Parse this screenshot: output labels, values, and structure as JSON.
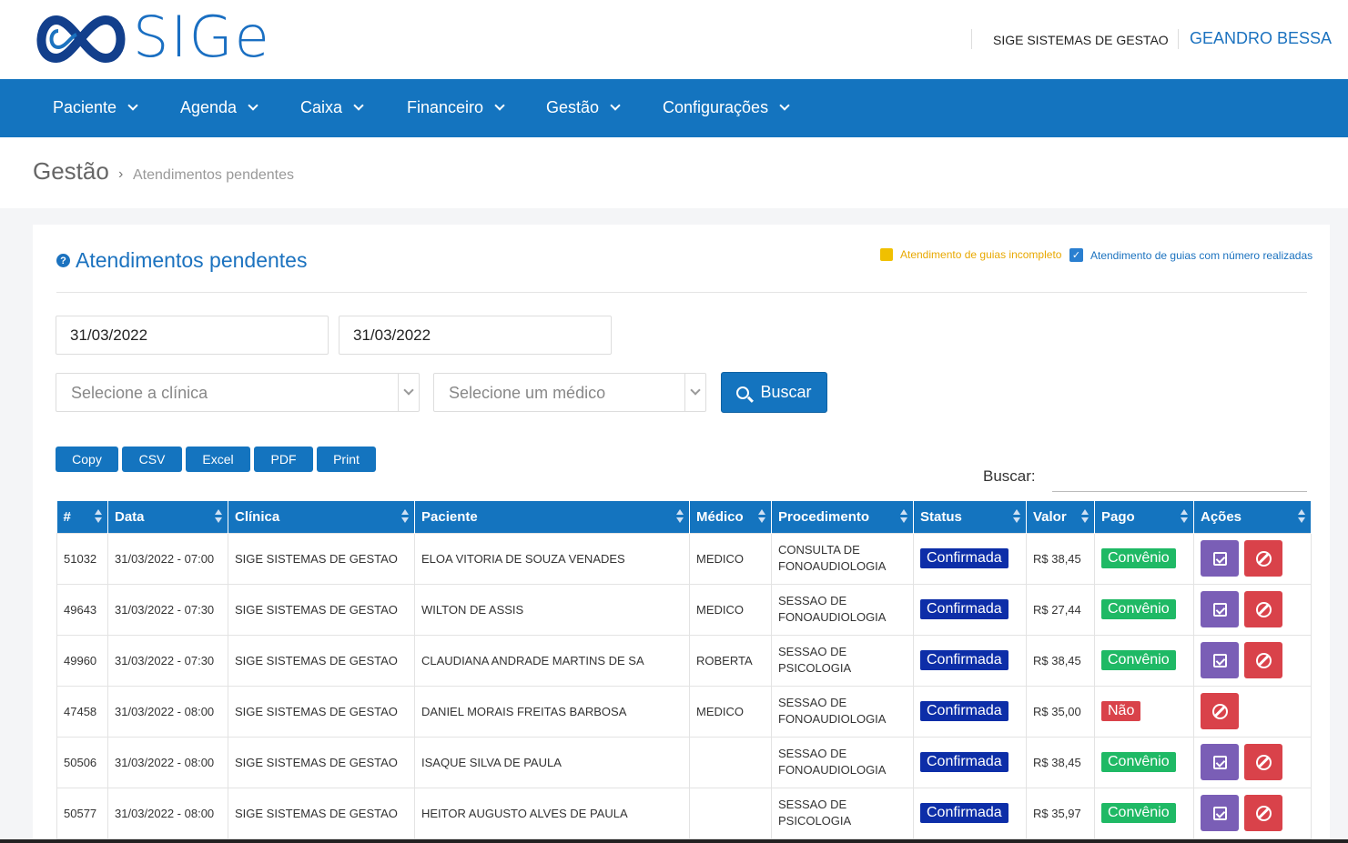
{
  "header": {
    "logo_text": "SIGe",
    "company": "SIGE SISTEMAS DE GESTAO",
    "user": "GEANDRO BESSA"
  },
  "nav": [
    {
      "label": "Paciente"
    },
    {
      "label": "Agenda"
    },
    {
      "label": "Caixa"
    },
    {
      "label": "Financeiro"
    },
    {
      "label": "Gestão"
    },
    {
      "label": "Configurações"
    }
  ],
  "breadcrumb": {
    "main": "Gestão",
    "separator": "›",
    "sub": "Atendimentos pendentes"
  },
  "card": {
    "title": "Atendimentos pendentes",
    "legend_incomplete": "Atendimento de guias incompleto",
    "legend_done": "Atendimento de guias com número realizadas"
  },
  "filters": {
    "date_start": "31/03/2022",
    "date_end": "31/03/2022",
    "clinic_placeholder": "Selecione a clínica",
    "doctor_placeholder": "Selecione um médico",
    "search_button": "Buscar"
  },
  "export": {
    "copy": "Copy",
    "csv": "CSV",
    "excel": "Excel",
    "pdf": "PDF",
    "print": "Print"
  },
  "table_search_label": "Buscar:",
  "table": {
    "columns": [
      "#",
      "Data",
      "Clínica",
      "Paciente",
      "Médico",
      "Procedimento",
      "Status",
      "Valor",
      "Pago",
      "Ações"
    ],
    "rows": [
      {
        "id": "51032",
        "data": "31/03/2022 - 07:00",
        "clinica": "SIGE SISTEMAS DE GESTAO",
        "paciente": "ELOA VITORIA DE SOUZA VENADES",
        "medico": "MEDICO",
        "proc1": "CONSULTA DE",
        "proc2": "FONOAUDIOLOGIA",
        "status": "Confirmada",
        "valor": "R$ 38,45",
        "pago": "Convênio"
      },
      {
        "id": "49643",
        "data": "31/03/2022 - 07:30",
        "clinica": "SIGE SISTEMAS DE GESTAO",
        "paciente": "WILTON DE ASSIS",
        "medico": "MEDICO",
        "proc1": "SESSAO DE",
        "proc2": "FONOAUDIOLOGIA",
        "status": "Confirmada",
        "valor": "R$ 27,44",
        "pago": "Convênio"
      },
      {
        "id": "49960",
        "data": "31/03/2022 - 07:30",
        "clinica": "SIGE SISTEMAS DE GESTAO",
        "paciente": "CLAUDIANA ANDRADE MARTINS DE SA",
        "medico": "ROBERTA",
        "proc1": "SESSAO DE",
        "proc2": "PSICOLOGIA",
        "status": "Confirmada",
        "valor": "R$ 38,45",
        "pago": "Convênio"
      },
      {
        "id": "47458",
        "data": "31/03/2022 - 08:00",
        "clinica": "SIGE SISTEMAS DE GESTAO",
        "paciente": "DANIEL MORAIS FREITAS BARBOSA",
        "medico": "MEDICO",
        "proc1": "SESSAO DE",
        "proc2": "FONOAUDIOLOGIA",
        "status": "Confirmada",
        "valor": "R$ 35,00",
        "pago": "Não"
      },
      {
        "id": "50506",
        "data": "31/03/2022 - 08:00",
        "clinica": "SIGE SISTEMAS DE GESTAO",
        "paciente": "ISAQUE SILVA DE PAULA",
        "medico": "",
        "proc1": "SESSAO DE",
        "proc2": "FONOAUDIOLOGIA",
        "status": "Confirmada",
        "valor": "R$ 38,45",
        "pago": "Convênio"
      },
      {
        "id": "50577",
        "data": "31/03/2022 - 08:00",
        "clinica": "SIGE SISTEMAS DE GESTAO",
        "paciente": "HEITOR AUGUSTO ALVES DE PAULA",
        "medico": "",
        "proc1": "SESSAO DE",
        "proc2": "PSICOLOGIA",
        "status": "Confirmada",
        "valor": "R$ 35,97",
        "pago": "Convênio"
      }
    ]
  },
  "colors": {
    "primary": "#1474bf",
    "status_confirmed": "#0d2ea8",
    "paid_convenio": "#1fb965",
    "paid_no": "#d9424a",
    "edit_action": "#7a5eb6",
    "cancel_action": "#d9424a",
    "legend_incomplete": "#f0c000"
  }
}
